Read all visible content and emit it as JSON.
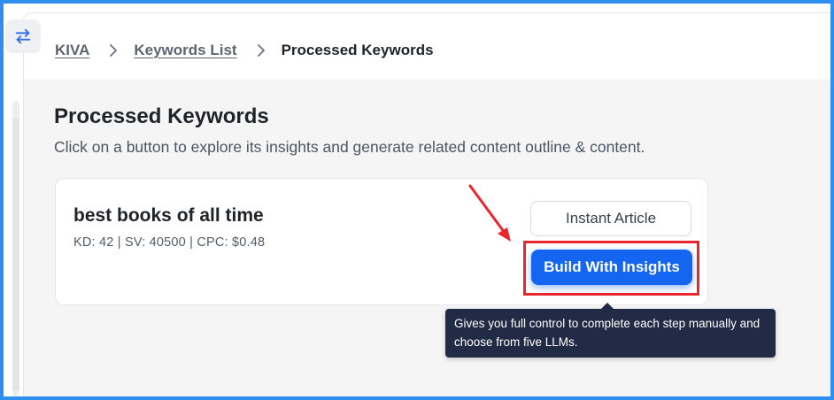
{
  "breadcrumb": {
    "items": [
      "KIVA",
      "Keywords List"
    ],
    "current": "Processed Keywords"
  },
  "page": {
    "title": "Processed Keywords",
    "subtitle": "Click on a button to explore its insights and generate related content outline & content."
  },
  "keyword_card": {
    "keyword": "best books of all time",
    "metrics": "KD: 42 | SV: 40500 | CPC: $0.48",
    "instant_article_label": "Instant Article",
    "build_with_insights_label": "Build With Insights"
  },
  "tooltip": {
    "text": "Gives you full control to complete each step manually and choose from five LLMs."
  },
  "icons": {
    "sidebar_toggle": "swap-arrows-icon",
    "breadcrumb_separator": "chevron-right-icon",
    "annotation": "red-arrow-annotation"
  },
  "colors": {
    "primary": "#1466f0",
    "annotation": "#e8262b",
    "tooltip_bg": "#222b45",
    "frame_border": "#2f8ff0"
  }
}
